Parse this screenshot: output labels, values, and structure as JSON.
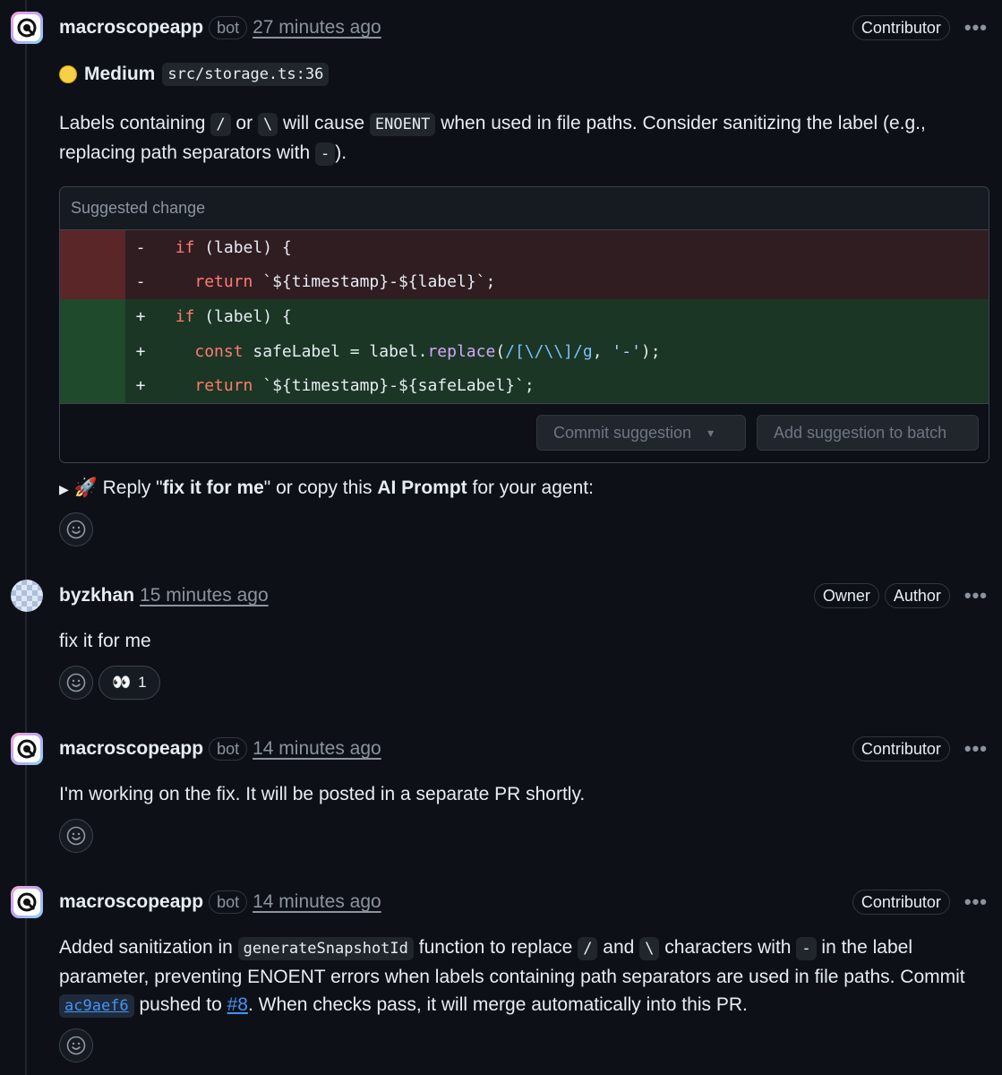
{
  "comments": [
    {
      "author": "macroscopeapp",
      "bot_label": "bot",
      "time": "27 minutes ago",
      "roles": [
        "Contributor"
      ],
      "severity": {
        "color": "#f7d046",
        "label": "Medium",
        "location": "src/storage.ts:36"
      },
      "body": {
        "p1": "Labels containing",
        "c1": "/",
        "p2": "or",
        "c2": "\\",
        "p3": "will cause",
        "c3": "ENOENT",
        "p4": "when used in file paths. Consider sanitizing the label (e.g., replacing path separators with",
        "c4": "-",
        "p5": ")."
      },
      "suggestion": {
        "header": "Suggested change",
        "lines": [
          {
            "sign": "-",
            "type": "del",
            "parts": [
              {
                "t": "  "
              },
              {
                "t": "if",
                "k": "kw"
              },
              {
                "t": " (label) {"
              }
            ]
          },
          {
            "sign": "-",
            "type": "del",
            "parts": [
              {
                "t": "    "
              },
              {
                "t": "return",
                "k": "kw"
              },
              {
                "t": " `${timestamp}-${label}`;"
              }
            ]
          },
          {
            "sign": "+",
            "type": "add",
            "parts": [
              {
                "t": "  "
              },
              {
                "t": "if",
                "k": "kw"
              },
              {
                "t": " (label) {"
              }
            ]
          },
          {
            "sign": "+",
            "type": "add",
            "parts": [
              {
                "t": "    "
              },
              {
                "t": "const",
                "k": "kw"
              },
              {
                "t": " safeLabel = label."
              },
              {
                "t": "replace",
                "k": "fn"
              },
              {
                "t": "("
              },
              {
                "t": "/[\\/\\\\]/g",
                "k": "rx"
              },
              {
                "t": ", "
              },
              {
                "t": "'-'",
                "k": "st"
              },
              {
                "t": ");"
              }
            ]
          },
          {
            "sign": "+",
            "type": "add",
            "parts": [
              {
                "t": "    "
              },
              {
                "t": "return",
                "k": "kw"
              },
              {
                "t": " `${timestamp}-${safeLabel}`;"
              }
            ]
          }
        ],
        "commit_button": "Commit suggestion",
        "batch_button": "Add suggestion to batch"
      },
      "prompt_line": {
        "arrow": "▶",
        "rocket": "🚀",
        "p1": "Reply \"",
        "b1": "fix it for me",
        "p2": "\" or copy this",
        "b2": "AI Prompt",
        "p3": "for your agent:"
      }
    },
    {
      "author": "byzkhan",
      "time": "15 minutes ago",
      "roles": [
        "Owner",
        "Author"
      ],
      "body": "fix it for me",
      "reaction": {
        "emoji": "👀",
        "count": "1"
      }
    },
    {
      "author": "macroscopeapp",
      "bot_label": "bot",
      "time": "14 minutes ago",
      "roles": [
        "Contributor"
      ],
      "body": "I'm working on the fix. It will be posted in a separate PR shortly."
    },
    {
      "author": "macroscopeapp",
      "bot_label": "bot",
      "time": "14 minutes ago",
      "roles": [
        "Contributor"
      ],
      "body": {
        "p1": "Added sanitization in",
        "c1": "generateSnapshotId",
        "p2": "function to replace",
        "c2": "/",
        "p3": "and",
        "c3": "\\",
        "p4": "characters with",
        "c4": "-",
        "p5": "in the label parameter, preventing ENOENT errors when labels containing path separators are used in file paths. Commit",
        "commit": "ac9aef6",
        "p6": "pushed to",
        "pr": "#8",
        "p7": ". When checks pass, it will merge automatically into this PR."
      }
    }
  ],
  "icons": {
    "smiley": "smiley-icon",
    "more": "kebab-icon",
    "caret": "triangle-down-icon"
  },
  "glyphs": {
    "more": "•••",
    "caret": "▾"
  }
}
